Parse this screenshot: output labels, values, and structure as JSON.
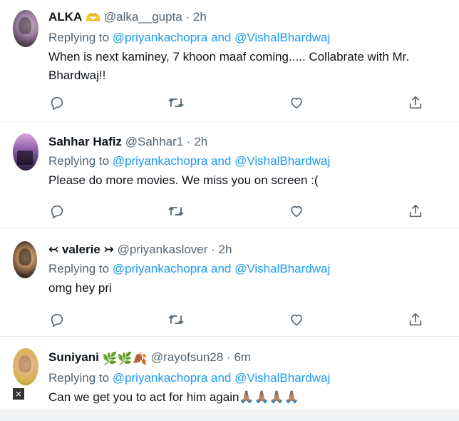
{
  "tweets": [
    {
      "name": "ALKA",
      "name_emoji": "🫶",
      "meta": "@alka__gupta · 2h",
      "reply_prefix": "Replying to",
      "reply_mentions": "@priyankachopra and @VishalBhardwaj",
      "text": "When is next kaminey, 7 khoon maaf coming..... Collabrate with Mr. Bhardwaj!!"
    },
    {
      "name": "Sahhar Hafiz",
      "name_emoji": "",
      "meta": "@Sahhar1 · 2h",
      "reply_prefix": "Replying to",
      "reply_mentions": "@priyankachopra and @VishalBhardwaj",
      "text": "Please do more movies. We miss you on screen :("
    },
    {
      "name": "↢ valerie ↣",
      "name_emoji": "",
      "meta": "@priyankaslover · 2h",
      "reply_prefix": "Replying to",
      "reply_mentions": "@priyankachopra and @VishalBhardwaj",
      "text": "omg hey pri"
    },
    {
      "name": "Suniyani",
      "name_emoji": "🌿🌿🍂",
      "meta": "@rayofsun28 · 6m",
      "reply_prefix": "Replying to",
      "reply_mentions": "@priyankachopra and @VishalBhardwaj",
      "text": "Can we get you to act for him again🙏🏽🙏🏽🙏🏽🙏🏽"
    }
  ],
  "close_badge": "×",
  "icons": {
    "reply": "reply-icon",
    "retweet": "retweet-icon",
    "like": "heart-icon",
    "share": "share-icon"
  },
  "colors": {
    "mention": "#1d9bf0",
    "secondary_text": "#536471",
    "primary_text": "#0f1419",
    "divider": "#e6ecf0"
  }
}
